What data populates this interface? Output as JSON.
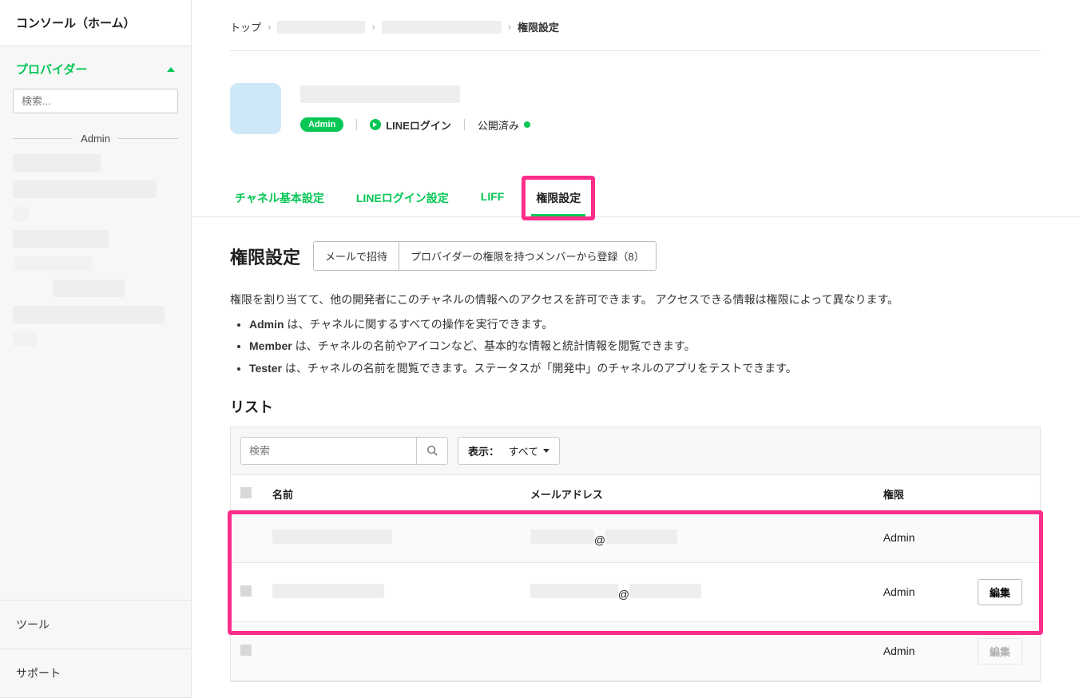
{
  "sidebar": {
    "home": "コンソール（ホーム）",
    "provider_label": "プロバイダー",
    "search_placeholder": "検索...",
    "admin_group": "Admin",
    "tools": "ツール",
    "support": "サポート"
  },
  "breadcrumb": {
    "top": "トップ",
    "current": "権限設定"
  },
  "channel": {
    "badge": "Admin",
    "login_type": "LINEログイン",
    "status": "公開済み"
  },
  "tabs": {
    "basic": "チャネル基本設定",
    "login": "LINEログイン設定",
    "liff": "LIFF",
    "roles": "権限設定"
  },
  "roles": {
    "title": "権限設定",
    "invite_email": "メールで招待",
    "register_member": "プロバイダーの権限を持つメンバーから登録（8）",
    "description": "権限を割り当てて、他の開発者にこのチャネルの情報へのアクセスを許可できます。 アクセスできる情報は権限によって異なります。",
    "bullets": {
      "admin_label": "Admin",
      "admin_text": " は、チャネルに関するすべての操作を実行できます。",
      "member_label": "Member",
      "member_text": " は、チャネルの名前やアイコンなど、基本的な情報と統計情報を閲覧できます。",
      "tester_label": "Tester",
      "tester_text": " は、チャネルの名前を閲覧できます。ステータスが「開発中」のチャネルのアプリをテストできます。"
    }
  },
  "list": {
    "heading": "リスト",
    "search_placeholder": "検索",
    "display_label": "表示：",
    "display_value": "すべて",
    "columns": {
      "name": "名前",
      "email": "メールアドレス",
      "role": "権限"
    },
    "rows": [
      {
        "email": "@",
        "role": "Admin",
        "editable": false
      },
      {
        "email": "@",
        "role": "Admin",
        "editable": true
      },
      {
        "email": "",
        "role": "Admin",
        "editable": true
      }
    ],
    "edit_label": "編集"
  }
}
